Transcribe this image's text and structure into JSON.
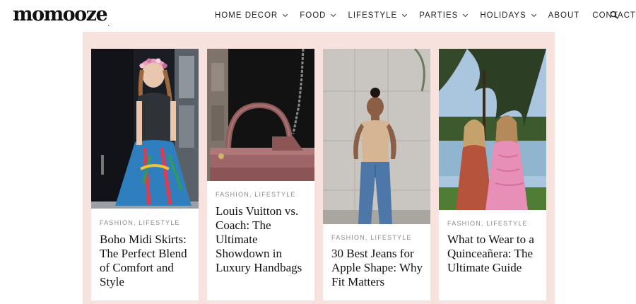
{
  "logo": {
    "text": "momooze",
    "mark": "."
  },
  "nav": {
    "items": [
      {
        "label": "HOME DECOR",
        "dropdown": true
      },
      {
        "label": "FOOD",
        "dropdown": true
      },
      {
        "label": "LIFESTYLE",
        "dropdown": true
      },
      {
        "label": "PARTIES",
        "dropdown": true
      },
      {
        "label": "HOLIDAYS",
        "dropdown": true
      },
      {
        "label": "ABOUT",
        "dropdown": false
      },
      {
        "label": "CONTACT",
        "dropdown": false
      }
    ],
    "search_icon": "search-icon"
  },
  "colors": {
    "panel_bg": "#f7e2de",
    "meta_text": "#8a8a8a"
  },
  "cards": [
    {
      "category": "FASHION, LIFESTYLE",
      "title": "Boho Midi Skirts: The Perfect Blend of Comfort and Style"
    },
    {
      "category": "FASHION, LIFESTYLE",
      "title": "Louis Vuitton vs. Coach: The Ultimate Showdown in Luxury Handbags"
    },
    {
      "category": "FASHION, LIFESTYLE",
      "title": "30 Best Jeans for Apple Shape: Why Fit Matters"
    },
    {
      "category": "FASHION, LIFESTYLE",
      "title": "What to Wear to a Quinceañera: The Ultimate Guide"
    }
  ]
}
